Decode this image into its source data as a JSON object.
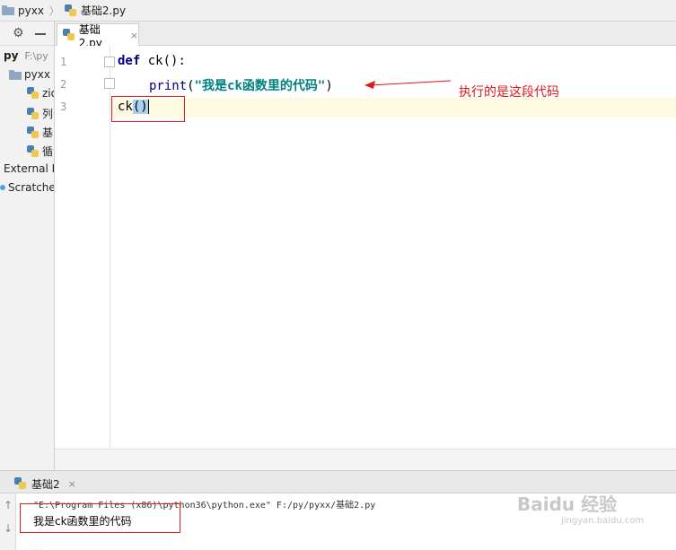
{
  "breadcrumb": {
    "project": "pyxx",
    "file": "基础2.py"
  },
  "project_panel": {
    "root_name": "py",
    "root_path": "F:\\py",
    "folder_name": "pyxx",
    "items": [
      "zid",
      "列",
      "基",
      "循"
    ],
    "external": "External L",
    "scratches": "Scratches"
  },
  "editor_tab": {
    "label": "基础2.py"
  },
  "gutter": {
    "lines": [
      "1",
      "2",
      "3"
    ]
  },
  "code": {
    "l1_kw": "def",
    "l1_rest": " ck():",
    "l2_builtin": "print",
    "l2_open": "(",
    "l2_str": "\"我是ck函数里的代码\"",
    "l2_close": ")",
    "l3_name": "ck",
    "l3_parens": "()"
  },
  "annotation": {
    "note": "执行的是这段代码",
    "color": "#e01818"
  },
  "run": {
    "tab_label": "基础2",
    "command": "\"E:\\Program Files (x86)\\python36\\python.exe\" F:/py/pyxx/基础2.py",
    "output": "我是ck函数里的代码",
    "truncated": "..."
  },
  "watermark": {
    "brand": "Baidu 经验",
    "url": "jingyan.baidu.com"
  }
}
